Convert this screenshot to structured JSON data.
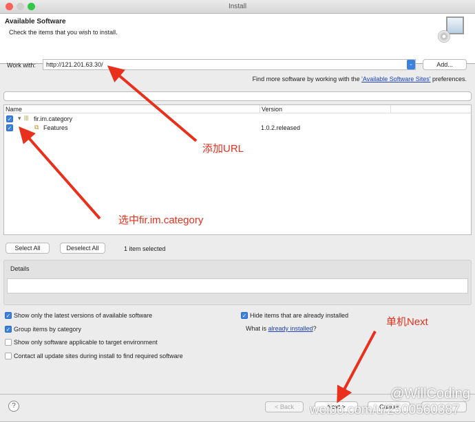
{
  "window": {
    "title": "Install"
  },
  "header": {
    "title": "Available Software",
    "subtitle": "Check the items that you wish to install."
  },
  "work_with": {
    "label": "Work with:",
    "value": "http://121.201.63.30/",
    "add_label": "Add..."
  },
  "find_more": {
    "prefix": "Find more software by working with the ",
    "link": "'Available Software Sites'",
    "suffix": " preferences."
  },
  "filter": {
    "value": ""
  },
  "table": {
    "columns": [
      "Name",
      "Version"
    ],
    "rows": [
      {
        "name": "fir.im.category",
        "version": "",
        "checked": true
      },
      {
        "name": "Features",
        "version": "1.0.2.released",
        "checked": true
      }
    ]
  },
  "selection": {
    "select_all": "Select All",
    "deselect_all": "Deselect All",
    "status": "1 item selected"
  },
  "details": {
    "label": "Details",
    "value": ""
  },
  "options": [
    {
      "label": "Show only the latest versions of available software",
      "checked": true
    },
    {
      "label": "Group items by category",
      "checked": true
    },
    {
      "label": "Show only software applicable to target environment",
      "checked": false
    },
    {
      "label": "Contact all update sites during install to find required software",
      "checked": false
    },
    {
      "label": "Hide items that are already installed",
      "checked": true
    }
  ],
  "already": {
    "prefix": "What is ",
    "link": "already installed",
    "suffix": "?"
  },
  "footer": {
    "back": "< Back",
    "next": "Next >",
    "cancel": "Cancel"
  },
  "annotations": {
    "add_url": "添加URL",
    "select": "选中fir.im.category",
    "click_next": "单机Next"
  },
  "watermark": {
    "handle": "@WillCoding",
    "url": "weibo.com/u/2500560387"
  },
  "colors": {
    "accent": "#3b82e0",
    "annotation": "#e8301c"
  }
}
